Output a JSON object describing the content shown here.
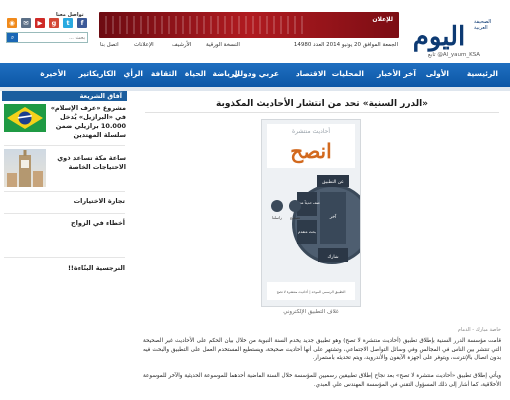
{
  "site": {
    "logo_text": "اليوم",
    "logo_tagline": "الصحيفة العربية",
    "twitter_handle": "تابع @Al_yaum_KSA",
    "follow_label": "تواصل معنا",
    "search_placeholder": "بحث ..."
  },
  "header": {
    "ad_banner_text": "للإعلان",
    "date_line": "الجمعة الموافق 20 يونيو 2014 العدد 14980",
    "paper_link": "النسخة الورقية",
    "archive_link": "الأرشيف",
    "ads_link": "الإعلانات",
    "contact_link": "اتصل بنا"
  },
  "social": [
    {
      "name": "rss-icon",
      "glyph": "◉",
      "color": "#f08a1c"
    },
    {
      "name": "email-icon",
      "glyph": "✉",
      "color": "#5b6f86"
    },
    {
      "name": "youtube-icon",
      "glyph": "▶",
      "color": "#cf2a27"
    },
    {
      "name": "googleplus-icon",
      "glyph": "g",
      "color": "#d34836"
    },
    {
      "name": "twitter-icon",
      "glyph": "t",
      "color": "#29a9e0"
    },
    {
      "name": "facebook-icon",
      "glyph": "f",
      "color": "#3b5998"
    }
  ],
  "nav": {
    "items": [
      "الرئيسية",
      "الأولى",
      "آخر الأخبار",
      "المحليات",
      "الاقتصاد",
      "عربي ودولي",
      "الرياضة",
      "الحياة",
      "الثقافة",
      "الرأي",
      "الكاريكاتير",
      "الأخيرة"
    ]
  },
  "sidebar": {
    "heading": "آفاق الشريعة",
    "items": [
      {
        "title": "مشروع «عرف الإسلام» في «البرازيل» يُدخل 10.000 برازيلي ضمن سلسلة المهتدين",
        "thumb": "flag"
      },
      {
        "title": "ساعة مكة تساعد ذوي الاحتياجات الخاصة",
        "thumb": "clock"
      },
      {
        "title": "تجارة الاختيارات",
        "thumb": ""
      },
      {
        "title": "أخطاء في الزواج",
        "thumb": ""
      },
      {
        "title": "النرجسية البنّاءة!!",
        "thumb": ""
      }
    ]
  },
  "article": {
    "title": "«الدرر السنية» تحد من انتشار الأحاديث المكذوبة",
    "figure": {
      "app_title": "انصح",
      "app_subtitle": "أحاديث منتشرة",
      "footer_text": "التطبيق الرسمي الموحد | أحاديث منتشرة لا تصح",
      "menu_top": "عن التطبيق",
      "menu_left": "أضف حديثاً منتشراً",
      "menu_right": "آخر",
      "menu_bottom_left": "بحث متقدم",
      "menu_bottom": "شارك",
      "btn_share": "راسلنا",
      "btn_note": "تصحيح"
    },
    "caption": "غلاف التطبيق الإلكتروني",
    "byline": "خاصة مبارك - الدمام",
    "paragraphs": [
      "قامت مؤسسة الدرر السنية بإطلاق تطبيق (أحاديث منتشرة لا تصح) وهو تطبيق جديد يخدم السنة النبوية من خلال بيان الحكم على الأحاديث غير الصحيحة التي تنتشر بين الناس في المجالس وفي وسائل التواصل الاجتماعي، وتشتهر على أنها أحاديث صحيحة، ويستطيع المستخدم العمل على التطبيق والبحث فيه بدون اتصال بالإنترنت، ويتوفر على أجهزة الآيفون والأندرويد، ويتم تحديثه باستمرار.",
      "ويأتي إطلاق تطبيق «أحاديث منتشرة لا تصح» بعد نجاح إطلاق تطبيقين رسميين للمؤسسة خلال السنة الماضية أحدهما للموسوعة الحديثية والآخر للموسوعة الأخلاقية، كما أشار إلى ذلك المسؤول التقني في المؤسسة المهندس علي العبدي."
    ]
  },
  "colors": {
    "brand": "#0d3a73",
    "nav": "#1565b8",
    "ad": "#a8161d"
  }
}
